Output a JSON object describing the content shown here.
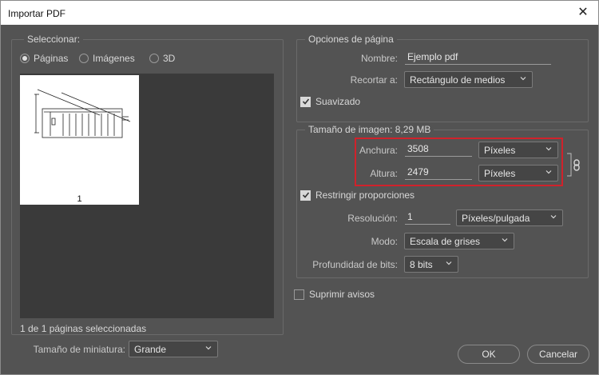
{
  "window": {
    "title": "Importar PDF",
    "close_glyph": "✕"
  },
  "select_panel": {
    "legend": "Seleccionar:",
    "options": [
      {
        "label": "Páginas",
        "selected": true
      },
      {
        "label": "Imágenes",
        "selected": false
      },
      {
        "label": "3D",
        "selected": false
      }
    ],
    "thumbnail_page_number": "1",
    "status_text": "1 de 1 páginas seleccionadas",
    "thumb_size_label": "Tamaño de miniatura:",
    "thumb_size_value": "Grande"
  },
  "page_options": {
    "legend": "Opciones de página",
    "name_label": "Nombre:",
    "name_value": "Ejemplo pdf",
    "crop_label": "Recortar a:",
    "crop_value": "Rectángulo de medios",
    "antialias_label": "Suavizado",
    "antialias_checked": true
  },
  "image_size": {
    "legend": "Tamaño de imagen: 8,29 MB",
    "width_label": "Anchura:",
    "width_value": "3508",
    "width_unit": "Píxeles",
    "height_label": "Altura:",
    "height_value": "2479",
    "height_unit": "Píxeles",
    "constrain_label": "Restringir proporciones",
    "constrain_checked": true,
    "resolution_label": "Resolución:",
    "resolution_value": "1",
    "resolution_unit": "Píxeles/pulgada",
    "mode_label": "Modo:",
    "mode_value": "Escala de grises",
    "depth_label": "Profundidad de bits:",
    "depth_value": "8 bits"
  },
  "suppress_warnings": {
    "label": "Suprimir avisos",
    "checked": false
  },
  "buttons": {
    "ok": "OK",
    "cancel": "Cancelar"
  },
  "colors": {
    "dialog_bg": "#535353",
    "highlight": "#d0222b",
    "thumb_area": "#3a3a3a"
  }
}
